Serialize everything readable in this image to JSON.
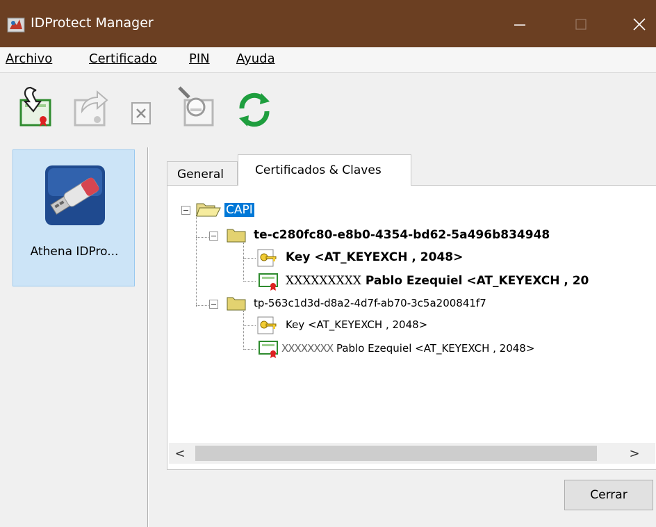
{
  "window": {
    "title": "IDProtect Manager",
    "controls": {
      "minimize": "—",
      "maximize": "☐",
      "close": "✕"
    },
    "title_bar_color": "#6b3f22"
  },
  "menu": [
    {
      "label": "Archivo"
    },
    {
      "label": "Certificado"
    },
    {
      "label": "PIN"
    },
    {
      "label": "Ayuda"
    }
  ],
  "toolbar": {
    "buttons": [
      {
        "icon": "import-certificate-icon"
      },
      {
        "icon": "export-certificate-icon"
      },
      {
        "icon": "delete-certificate-icon"
      },
      {
        "icon": "view-certificate-icon"
      },
      {
        "icon": "refresh-icon"
      }
    ]
  },
  "devices": [
    {
      "label": "Athena IDPro...",
      "icon": "usb-token-icon",
      "selected": true
    }
  ],
  "tabs": [
    {
      "label": "General",
      "active": false
    },
    {
      "label": "Certificados & Claves",
      "active": true
    }
  ],
  "tree": {
    "root": {
      "label": "CAPI",
      "selected": true,
      "icon": "open-folder-icon"
    },
    "containers": [
      {
        "label": "te-c280fc80-e8b0-4354-bd62-5a496b834948",
        "bold": true,
        "icon": "folder-icon",
        "children": [
          {
            "type": "key",
            "label": "Key  <AT_KEYEXCH , 2048>",
            "icon": "key-icon"
          },
          {
            "type": "cert",
            "masked": "XXXXXXXXX",
            "label": " Pablo Ezequiel <AT_KEYEXCH , 20",
            "icon": "certificate-icon"
          }
        ]
      },
      {
        "label": "tp-563c1d3d-d8a2-4d7f-ab70-3c5a200841f7",
        "bold": false,
        "icon": "folder-icon",
        "children": [
          {
            "type": "key",
            "label": "Key  <AT_KEYEXCH , 2048>",
            "icon": "key-icon"
          },
          {
            "type": "cert",
            "masked": "XXXXXXXX",
            "label": "  Pablo Ezequiel <AT_KEYEXCH , 2048>",
            "icon": "certificate-icon"
          }
        ]
      }
    ]
  },
  "scrollbar": {
    "left_arrow": "<",
    "right_arrow": ">"
  },
  "buttons": {
    "close": "Cerrar"
  },
  "colors": {
    "selection": "#0078d7",
    "device_tile": "#cce4f7",
    "panel": "#f0f0f0"
  }
}
